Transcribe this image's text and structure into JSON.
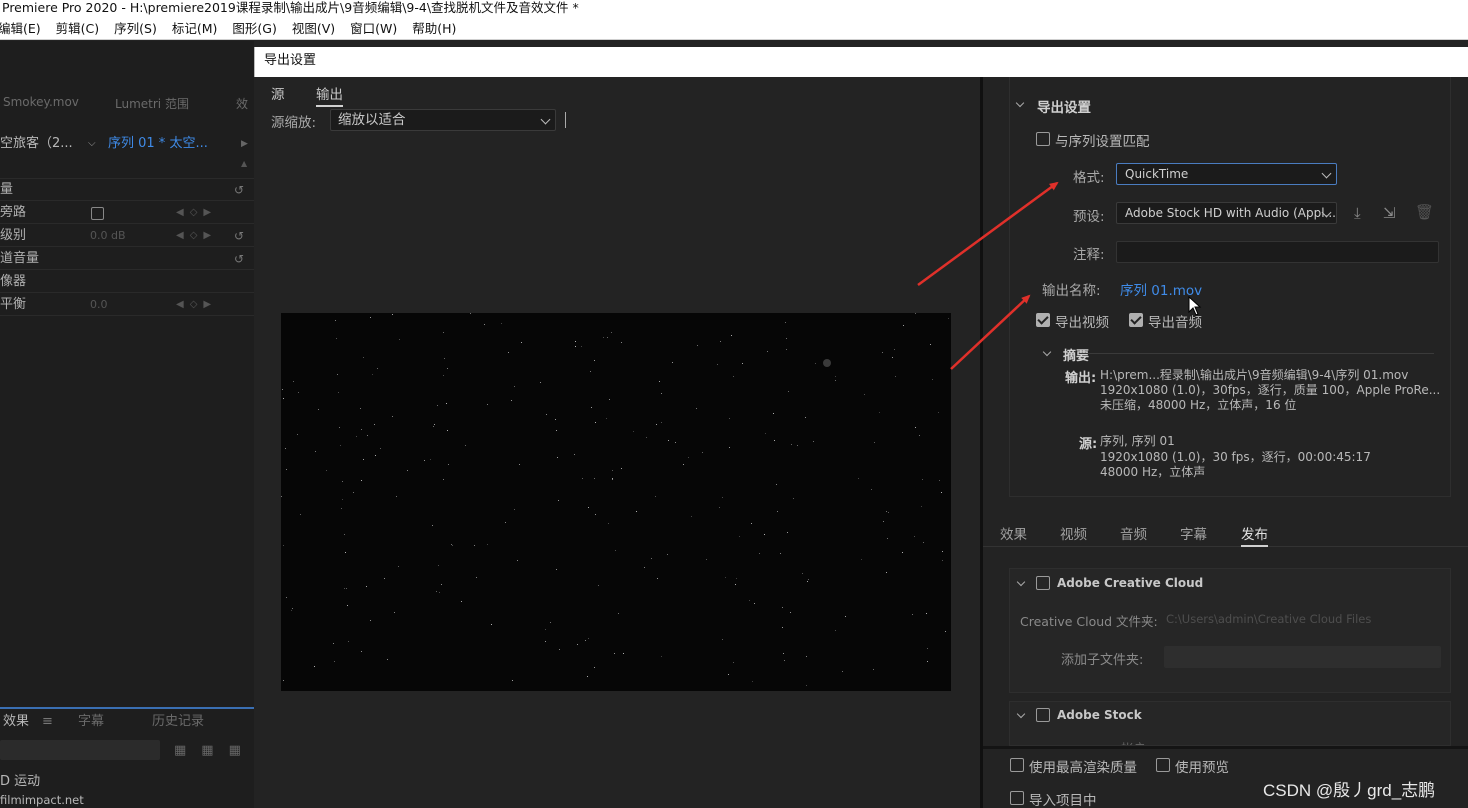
{
  "app": {
    "window_title": "Premiere Pro 2020 - H:\\premiere2019课程录制\\输出成片\\9音频编辑\\9-4\\查找脱机文件及音效文件 *",
    "menu": [
      "编辑(E)",
      "剪辑(C)",
      "序列(S)",
      "标记(M)",
      "图形(G)",
      "视图(V)",
      "窗口(W)",
      "帮助(H)"
    ]
  },
  "left_panel": {
    "tabs": [
      "Smokey.mov",
      "Lumetri 范围",
      "效"
    ],
    "sequence_source": "空旅客（2...",
    "sequence_target": "序列 01 * 太空...",
    "rows": [
      {
        "label": "量",
        "value": ""
      },
      {
        "label": "旁路",
        "value": ""
      },
      {
        "label": "级别",
        "value": "0.0 dB"
      },
      {
        "label": "道音量",
        "value": ""
      },
      {
        "label": "像器",
        "value": ""
      },
      {
        "label": "平衡",
        "value": "0.0"
      }
    ],
    "bottom_tabs": [
      "效果",
      "字幕",
      "历史记录"
    ],
    "items": [
      "D 运动",
      "filmimpact.net"
    ]
  },
  "dialog": {
    "title": "导出设置",
    "tabs": [
      "源",
      "输出"
    ],
    "active_tab": "输出",
    "zoom_label": "源缩放:",
    "zoom_value": "缩放以适合"
  },
  "export_settings": {
    "section_title": "导出设置",
    "match_sequence_label": "与序列设置匹配",
    "match_sequence_checked": false,
    "format_label": "格式:",
    "format_value": "QuickTime",
    "preset_label": "预设:",
    "preset_value": "Adobe Stock HD with Audio (Appl...",
    "comment_label": "注释:",
    "comment_value": "",
    "output_name_label": "输出名称:",
    "output_name_value": "序列 01.mov",
    "export_video_label": "导出视频",
    "export_video_checked": true,
    "export_audio_label": "导出音频",
    "export_audio_checked": true,
    "summary_title": "摘要",
    "summary_output_label": "输出:",
    "summary_output_lines": [
      "H:\\prem...程录制\\输出成片\\9音频编辑\\9-4\\序列 01.mov",
      "1920x1080 (1.0)，30fps，逐行，质量 100，Apple ProRe...",
      "未压缩，48000 Hz，立体声，16 位"
    ],
    "summary_source_label": "源:",
    "summary_source_lines": [
      "序列, 序列 01",
      "1920x1080 (1.0)，30 fps，逐行，00:00:45:17",
      "48000 Hz，立体声"
    ]
  },
  "settings_tabs": {
    "items": [
      "效果",
      "视频",
      "音频",
      "字幕",
      "发布"
    ],
    "active": "发布"
  },
  "publish": {
    "cc_title": "Adobe Creative Cloud",
    "cc_checked": false,
    "cc_folder_label": "Creative Cloud 文件夹:",
    "cc_folder_value": "C:\\Users\\admin\\Creative Cloud Files",
    "add_subfolder_label": "添加子文件夹:",
    "stock_title": "Adobe Stock",
    "stock_checked": false,
    "stock_partial_label": "帐户"
  },
  "footer": {
    "max_render_label": "使用最高渲染质量",
    "use_previews_label": "使用预览",
    "import_label": "导入项目中"
  },
  "watermark": "CSDN @殷丿grd_志鹏",
  "icon_names": [
    "save-preset-icon",
    "import-preset-icon",
    "delete-preset-icon",
    "chevron-down-icon",
    "mouse-cursor-icon"
  ],
  "colors": {
    "accent": "#3f8be8",
    "annotation_arrow": "#e0302a",
    "dialog_bg": "#232323"
  }
}
